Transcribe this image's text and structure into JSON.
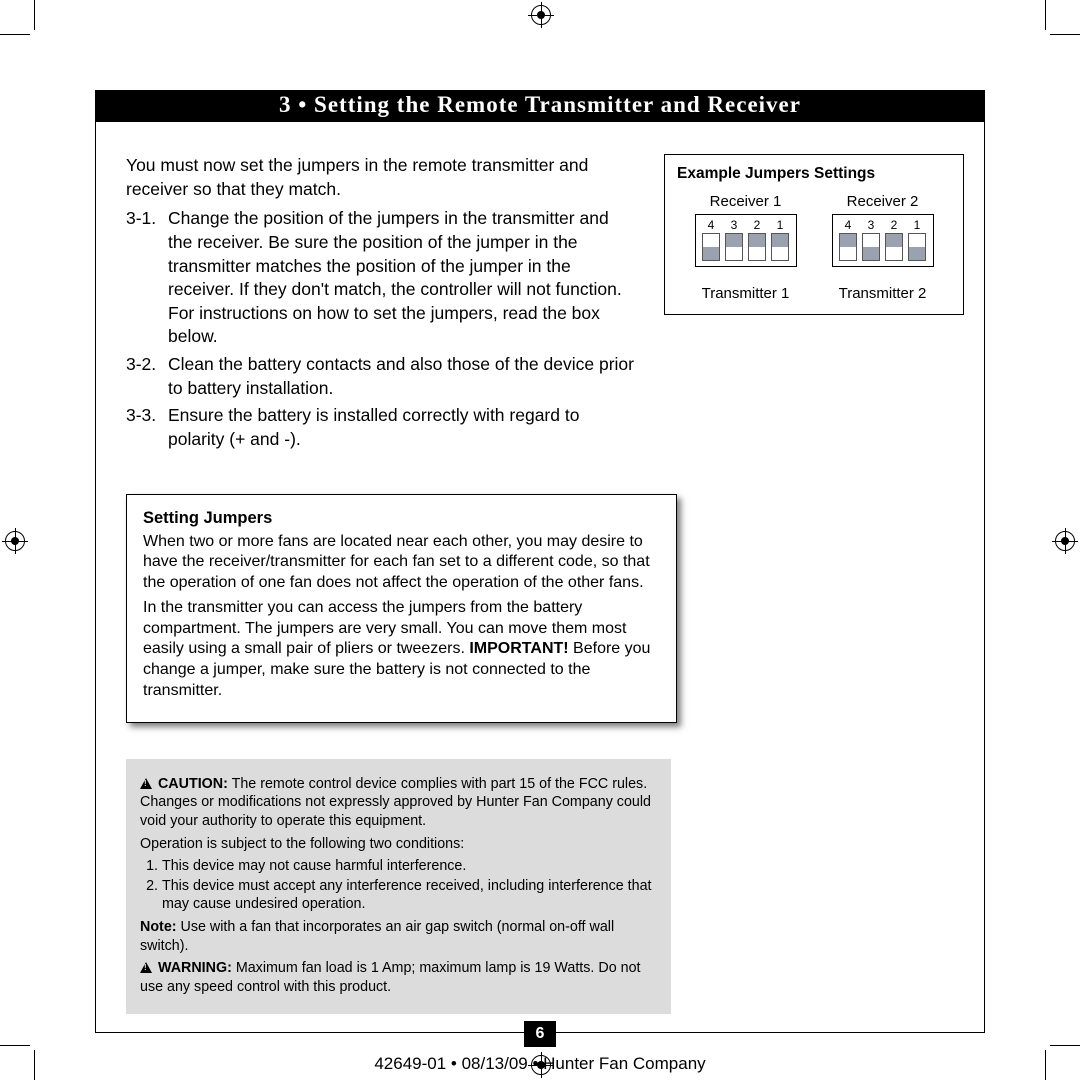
{
  "header": {
    "title": "3 • Setting the Remote Transmitter and Receiver"
  },
  "intro": "You must now set the jumpers in the remote transmitter and receiver so that they match.",
  "steps": [
    {
      "num": "3-1.",
      "text": "Change the position of the jumpers in the transmitter and the receiver. Be sure the position of the jumper in the transmitter matches the position of the jumper in the receiver. If they don't match, the controller will not function. For instructions on how to set the jumpers, read the box below."
    },
    {
      "num": "3-2.",
      "text": "Clean the battery contacts and also those of the device prior to battery installation."
    },
    {
      "num": "3-3.",
      "text": " Ensure the battery is installed correctly with regard to polarity (+ and -)."
    }
  ],
  "jumper_panel": {
    "title": "Example Jumpers Settings",
    "receiver1": "Receiver 1",
    "receiver2": "Receiver 2",
    "transmitter1": "Transmitter 1",
    "transmitter2": "Transmitter 2",
    "nums": [
      "4",
      "3",
      "2",
      "1"
    ]
  },
  "setting_box": {
    "title": "Setting Jumpers",
    "p1": "When two or more fans are located near each other, you may desire to have the receiver/transmitter for each fan set to a different code, so that the operation of one fan does not affect the operation of the other fans.",
    "p2a": "In the transmitter you can access the jumpers from the battery compartment. The jumpers are very small. You can move them most easily using a small pair of pliers or tweezers. ",
    "p2b": "IMPORTANT!",
    "p2c": " Before you change  a jumper, make sure the battery is not connected to the transmitter."
  },
  "caution_box": {
    "caution_label": "CAUTION:",
    "caution_text": " The remote control device complies with part 15 of the FCC rules. Changes or modifications not expressly approved by Hunter Fan Company could void your authority to operate this equipment.",
    "op_intro": "Operation is subject to the following two conditions:",
    "cond1": "This device may not cause harmful interference.",
    "cond2": "This device must accept any interference received, including interference that may cause undesired operation.",
    "note_label": "Note:",
    "note_text": " Use with a fan that incorporates an air gap switch (normal on-off wall switch).",
    "warn_label": "WARNING:",
    "warn_text": " Maximum fan load is 1 Amp; maximum lamp is 19 Watts. Do not use any speed control with this product."
  },
  "page_number": "6",
  "footer": "42649-01  •  08/13/09  •  Hunter Fan Company",
  "chart_data": {
    "type": "table",
    "title": "Example Jumpers Settings",
    "description": "DIP switch positions (1=up, 0=down) for switches labeled 4,3,2,1",
    "devices": [
      {
        "name": "Receiver 1",
        "switches": {
          "4": 0,
          "3": 1,
          "2": 1,
          "1": 1
        }
      },
      {
        "name": "Transmitter 1",
        "switches": {
          "4": 0,
          "3": 1,
          "2": 1,
          "1": 1
        }
      },
      {
        "name": "Receiver 2",
        "switches": {
          "4": 1,
          "3": 0,
          "2": 1,
          "1": 0
        }
      },
      {
        "name": "Transmitter 2",
        "switches": {
          "4": 1,
          "3": 0,
          "2": 1,
          "1": 0
        }
      }
    ]
  }
}
